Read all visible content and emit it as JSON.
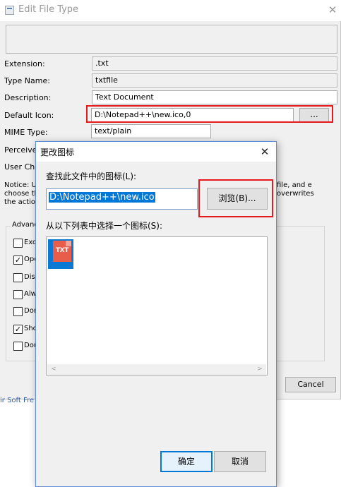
{
  "background_window": {
    "title": "Edit File Type",
    "close_glyph": "✕",
    "fields": {
      "extension": {
        "label": "Extension:",
        "value": ".txt"
      },
      "type_name": {
        "label": "Type Name:",
        "value": "txtfile"
      },
      "description": {
        "label": "Description:",
        "value": "Text Document"
      },
      "default_icon": {
        "label": "Default Icon:",
        "value": "D:\\Notepad++\\new.ico,0",
        "button": "..."
      },
      "mime_type": {
        "label": "MIME Type:",
        "value": "text/plain"
      }
    },
    "perceived_label": "Perceived",
    "user_choice_label": "User Choi",
    "notice_left": "Notice: Us choose th the action",
    "notice_right": "file, and e overwrites",
    "advanced_group_title": "Advanc",
    "checkboxes": [
      {
        "label": "Exc",
        "checked": false
      },
      {
        "label": "Ope",
        "checked": true
      },
      {
        "label": "Disa",
        "checked": false
      },
      {
        "label": "Alw",
        "checked": false
      },
      {
        "label": "Don",
        "checked": false
      },
      {
        "label": "Sho",
        "checked": true
      },
      {
        "label": "Don",
        "checked": false
      }
    ],
    "cancel_button": "Cancel",
    "lower_text": "ir Soft Fre"
  },
  "dialog": {
    "title": "更改图标",
    "close_glyph": "✕",
    "find_label": "查找此文件中的图标(L):",
    "path_value": "D:\\Notepad++\\new.ico",
    "browse_button": "浏览(B)...",
    "list_label": "从以下列表中选择一个图标(S):",
    "icon_badge_text": "TXT",
    "scroll_left": "<",
    "scroll_right": ">",
    "ok_button": "确定",
    "cancel_button": "取消"
  },
  "colors": {
    "highlight_red": "#e8191b",
    "selection_blue": "#0078d7",
    "icon_tile_blue": "#0a79d3",
    "icon_page_red": "#e85c4a"
  }
}
